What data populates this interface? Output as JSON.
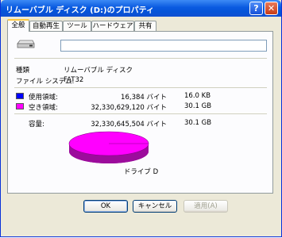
{
  "window": {
    "title": "リムーバブル ディスク (D:)のプロパティ",
    "help_glyph": "?",
    "close_glyph": "✕"
  },
  "tabs": [
    {
      "label": "全般",
      "active": true
    },
    {
      "label": "自動再生",
      "active": false
    },
    {
      "label": "ツール",
      "active": false
    },
    {
      "label": "ハードウェア",
      "active": false
    },
    {
      "label": "共有",
      "active": false
    }
  ],
  "general": {
    "volume_label_value": "",
    "icon": "removable-drive-icon",
    "type_label": "種類",
    "type_value": "リムーバブル ディスク",
    "fs_label": "ファイル システム:",
    "fs_value": "FAT32",
    "used_label": "使用領域:",
    "used_bytes": "16,384 バイト",
    "used_size": "16.0 KB",
    "used_color": "#0000ff",
    "free_label": "空き領域:",
    "free_bytes": "32,330,629,120 バイト",
    "free_size": "30.1 GB",
    "free_color": "#ff00ff",
    "capacity_label": "容量:",
    "capacity_bytes": "32,330,645,504 バイト",
    "capacity_size": "30.1 GB",
    "drive_caption": "ドライブ D",
    "used_fraction": 5e-07
  },
  "buttons": {
    "ok": "OK",
    "cancel": "キャンセル",
    "apply": "適用(A)"
  }
}
